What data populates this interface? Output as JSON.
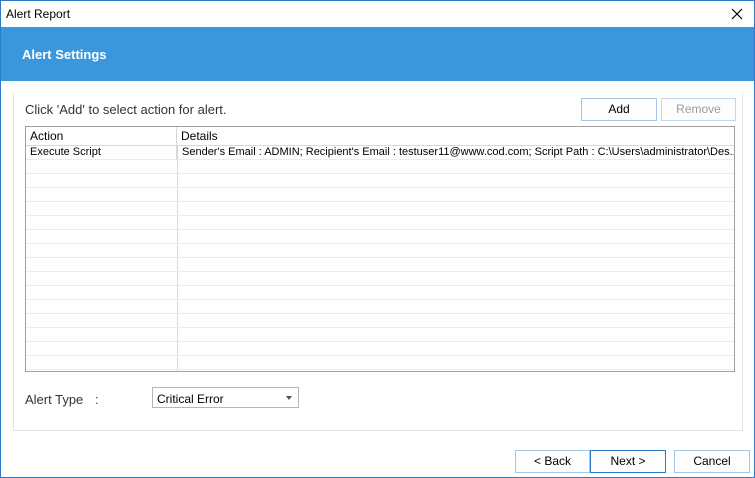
{
  "window": {
    "title": "Alert Report",
    "close_icon": "close-icon"
  },
  "banner": {
    "heading": "Alert Settings"
  },
  "instruction": "Click 'Add' to select action for alert.",
  "actions": {
    "add_label": "Add",
    "remove_label": "Remove"
  },
  "table": {
    "columns": [
      "Action",
      "Details"
    ],
    "rows": [
      {
        "action": "Execute Script",
        "details": "Sender's Email : ADMIN; Recipient's Email : testuser11@www.cod.com; Script Path : C:\\Users\\administrator\\Des..."
      }
    ]
  },
  "alert_type": {
    "label": "Alert Type",
    "colon": ":",
    "selected": "Critical Error"
  },
  "footer": {
    "back_label": "< Back",
    "next_label": "Next >",
    "cancel_label": "Cancel"
  },
  "colors": {
    "banner": "#3a97db",
    "window_border": "#2b79c9"
  }
}
